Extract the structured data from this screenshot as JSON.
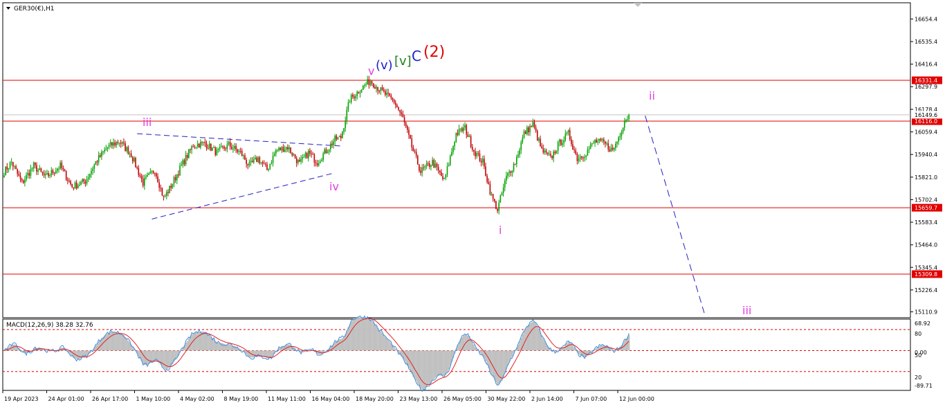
{
  "window": {
    "symbol_title": "GER30(€),H1",
    "macd_title": "MACD(12,26,9) 38.28 32.76"
  },
  "colors": {
    "bull_candle": "#00a000",
    "bear_candle": "#c00000",
    "level_line": "#e00000",
    "price_marker": "#c0c0c0",
    "wave_magenta": "#e040e0",
    "wave_blue": "#2020d0",
    "wave_green": "#208020",
    "wave_red": "#e00000",
    "trendline": "#2020c0",
    "macd_hist": "#c0c0c0",
    "macd_line": "#4090e0",
    "signal_line": "#e02020"
  },
  "chart_data": [
    {
      "type": "candlestick",
      "title": "GER30(€),H1",
      "ylim": [
        15080,
        16740
      ],
      "y_ticks": [
        "16654.4",
        "16535.4",
        "16416.4",
        "16297.9",
        "16178.4",
        "16059.4",
        "15940.4",
        "15821.0",
        "15702.4",
        "15583.4",
        "15464.0",
        "15345.4",
        "15226.4",
        "15110.9"
      ],
      "x_ticks": [
        "19 Apr 2023",
        "24 Apr 01:00",
        "26 Apr 17:00",
        "1 May 10:00",
        "4 May 02:00",
        "8 May 19:00",
        "11 May 11:00",
        "16 May 04:00",
        "18 May 20:00",
        "23 May 13:00",
        "26 May 05:00",
        "30 May 22:00",
        "2 Jun 14:00",
        "7 Jun 07:00",
        "12 Jun 00:00"
      ],
      "path_keypoints": [
        [
          0,
          15850
        ],
        [
          5,
          15900
        ],
        [
          12,
          15790
        ],
        [
          20,
          15880
        ],
        [
          28,
          15820
        ],
        [
          38,
          15880
        ],
        [
          46,
          15770
        ],
        [
          55,
          15800
        ],
        [
          62,
          15900
        ],
        [
          70,
          15980
        ],
        [
          78,
          16010
        ],
        [
          86,
          15940
        ],
        [
          94,
          15790
        ],
        [
          102,
          15860
        ],
        [
          108,
          15710
        ],
        [
          112,
          15760
        ],
        [
          120,
          15880
        ],
        [
          128,
          15990
        ],
        [
          136,
          16000
        ],
        [
          144,
          15950
        ],
        [
          152,
          15990
        ],
        [
          160,
          15950
        ],
        [
          166,
          15880
        ],
        [
          172,
          15920
        ],
        [
          178,
          15860
        ],
        [
          184,
          15960
        ],
        [
          192,
          15980
        ],
        [
          200,
          15890
        ],
        [
          206,
          15950
        ],
        [
          212,
          15900
        ],
        [
          218,
          15960
        ],
        [
          224,
          16020
        ],
        [
          228,
          16030
        ],
        [
          234,
          16230
        ],
        [
          242,
          16290
        ],
        [
          248,
          16330
        ],
        [
          256,
          16270
        ],
        [
          264,
          16220
        ],
        [
          270,
          16130
        ],
        [
          276,
          15980
        ],
        [
          282,
          15850
        ],
        [
          290,
          15900
        ],
        [
          298,
          15800
        ],
        [
          306,
          16050
        ],
        [
          312,
          16080
        ],
        [
          318,
          15960
        ],
        [
          324,
          15900
        ],
        [
          330,
          15720
        ],
        [
          334,
          15650
        ],
        [
          340,
          15820
        ],
        [
          346,
          15900
        ],
        [
          352,
          16050
        ],
        [
          358,
          16100
        ],
        [
          364,
          15960
        ],
        [
          370,
          15920
        ],
        [
          376,
          16000
        ],
        [
          382,
          16050
        ],
        [
          388,
          15920
        ],
        [
          394,
          15950
        ],
        [
          400,
          16010
        ],
        [
          406,
          16000
        ],
        [
          412,
          15960
        ],
        [
          416,
          16030
        ],
        [
          420,
          16120
        ],
        [
          423,
          16148
        ]
      ],
      "current_price": 16149.6,
      "levels": [
        {
          "value": 16331.4,
          "label": "16331.4"
        },
        {
          "value": 16116.0,
          "label": "16116.0"
        },
        {
          "value": 15659.7,
          "label": "15659.7"
        },
        {
          "value": 15309.8,
          "label": "15309.8"
        }
      ],
      "current_price_label": "16149.6",
      "annotations": [
        {
          "text": "v",
          "series": "magenta"
        },
        {
          "text": "(v)",
          "series": "blue"
        },
        {
          "text": "[v]",
          "series": "green"
        },
        {
          "text": "C",
          "series": "blue"
        },
        {
          "text": "(2)",
          "series": "red"
        },
        {
          "text": "iii",
          "series": "magenta"
        },
        {
          "text": "iv",
          "series": "magenta"
        },
        {
          "text": "i",
          "series": "magenta"
        },
        {
          "text": "ii",
          "series": "magenta"
        },
        {
          "text": "iii",
          "series": "magenta"
        }
      ],
      "trendlines": [
        {
          "from": [
            90,
            16050
          ],
          "to": [
            228,
            15985
          ]
        },
        {
          "from": [
            100,
            15600
          ],
          "to": [
            222,
            15840
          ]
        }
      ],
      "projection": [
        [
          434,
          16145
        ],
        [
          474,
          15105
        ]
      ]
    },
    {
      "type": "macd",
      "title": "MACD(12,26,9) 38.28 32.76",
      "ylim": [
        -95,
        75
      ],
      "y_ticks": [
        "68.92",
        "80",
        "50",
        "0.00",
        "20",
        "-89.71"
      ],
      "params": [
        12,
        26,
        9
      ],
      "last_macd": 38.28,
      "last_signal": 32.76,
      "levels": [
        50,
        0,
        -50
      ]
    }
  ]
}
